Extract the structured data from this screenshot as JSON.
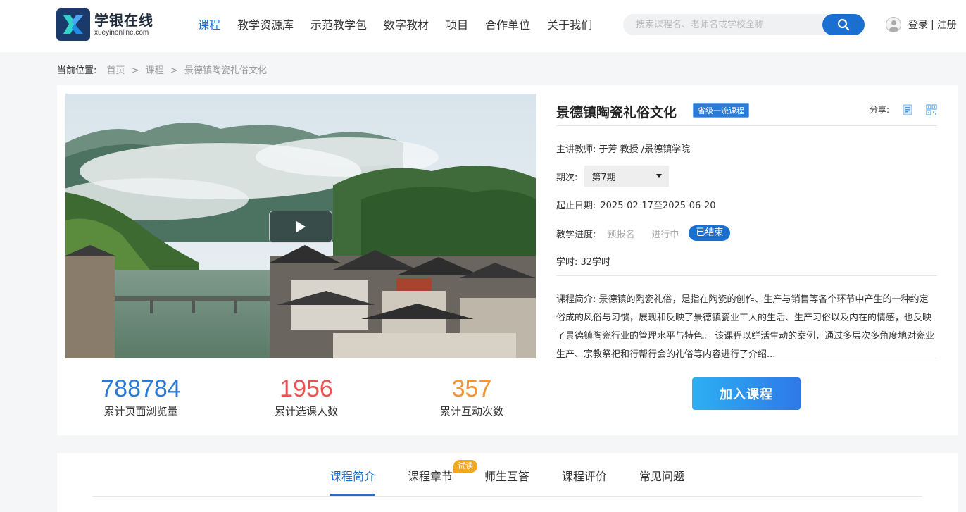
{
  "brand": {
    "name_cn": "学银在线",
    "name_en": "xueyinonline.com"
  },
  "nav": {
    "items": [
      {
        "label": "课程",
        "active": true
      },
      {
        "label": "教学资源库"
      },
      {
        "label": "示范教学包"
      },
      {
        "label": "数字教材"
      },
      {
        "label": "项目"
      },
      {
        "label": "合作单位"
      },
      {
        "label": "关于我们"
      }
    ]
  },
  "search": {
    "placeholder": "搜索课程名、老师名或学校全称",
    "value": ""
  },
  "user": {
    "login": "登录",
    "separator": "|",
    "register": "注册"
  },
  "breadcrumb": {
    "label": "当前位置:",
    "items": [
      "首页",
      "课程",
      "景德镇陶瓷礼俗文化"
    ],
    "separator": ">"
  },
  "course": {
    "title": "景德镇陶瓷礼俗文化",
    "badge": "省级一流课程",
    "share_label": "分享:",
    "teacher": "主讲教师: 于芳 教授 /景德镇学院",
    "term_label": "期次:",
    "term_value": "第7期",
    "date_label": "起止日期:",
    "date_value": "2025-02-17至2025-06-20",
    "progress_label": "教学进度:",
    "progress_steps": [
      "预报名",
      "进行中",
      "已结束"
    ],
    "progress_current": "已结束",
    "hours": "学时: 32学时",
    "description": "课程简介:  景德镇的陶瓷礼俗，是指在陶瓷的创作、生产与销售等各个环节中产生的一种约定俗成的风俗与习惯，展现和反映了景德镇瓷业工人的生活、生产习俗以及内在的情感，也反映了景德镇陶瓷行业的管理水平与特色。 该课程以鲜活生动的案例，通过多层次多角度地对瓷业生产、宗教祭祀和行帮行会的礼俗等内容进行了介绍...",
    "join_label": "加入课程"
  },
  "stats": [
    {
      "value": "788784",
      "label": "累计页面浏览量",
      "color": "#2a7bd8"
    },
    {
      "value": "1956",
      "label": "累计选课人数",
      "color": "#e8544f"
    },
    {
      "value": "357",
      "label": "累计互动次数",
      "color": "#f2942f"
    }
  ],
  "tabs": {
    "items": [
      {
        "label": "课程简介",
        "active": true
      },
      {
        "label": "课程章节"
      },
      {
        "label": "师生互答"
      },
      {
        "label": "课程评价"
      },
      {
        "label": "常见问题"
      }
    ],
    "trial_badge": "试读"
  },
  "icons": {
    "search": "search-icon",
    "play": "play-icon",
    "share_book": "book-icon",
    "share_qr": "qrcode-icon",
    "user": "user-avatar-icon"
  },
  "colors": {
    "accent": "#1a6fd0",
    "badge": "#2a7bd8",
    "trial": "#f5a623"
  }
}
